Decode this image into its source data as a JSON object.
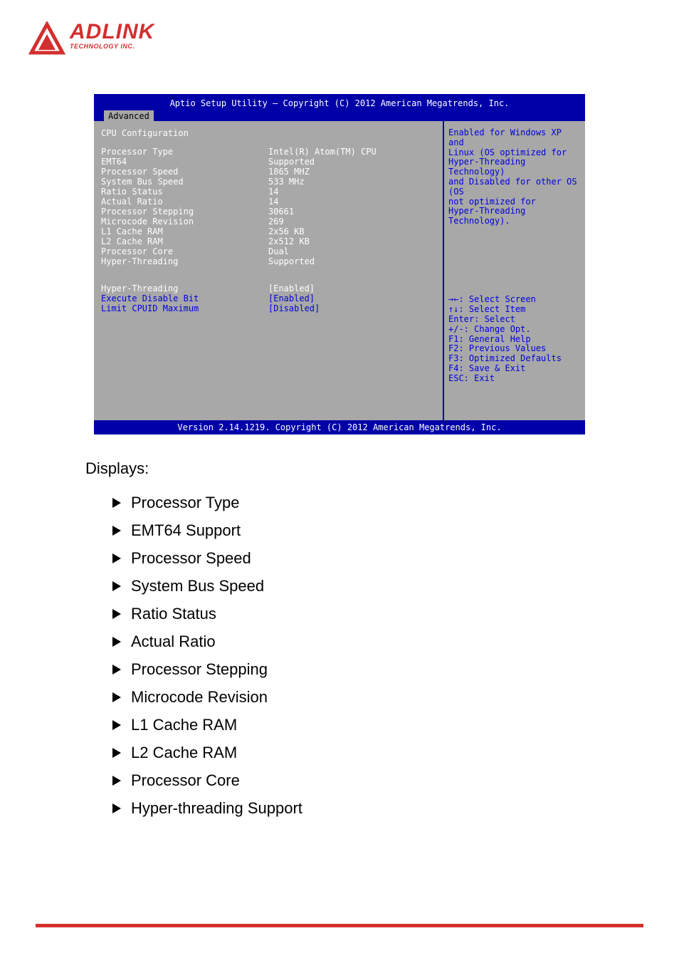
{
  "logo": {
    "main": "ADLINK",
    "sub": "TECHNOLOGY INC."
  },
  "bios": {
    "header": "Aptio Setup Utility – Copyright (C) 2012 American Megatrends, Inc.",
    "tab": "Advanced",
    "section": "CPU Configuration",
    "info": [
      {
        "label": "Processor Type",
        "value": "Intel(R) Atom(TM) CPU"
      },
      {
        "label": "EMT64",
        "value": "Supported"
      },
      {
        "label": "Processor Speed",
        "value": "1865 MHZ"
      },
      {
        "label": "System Bus Speed",
        "value": "533 MHz"
      },
      {
        "label": "Ratio Status",
        "value": "14"
      },
      {
        "label": "Actual Ratio",
        "value": "14"
      },
      {
        "label": "Processor Stepping",
        "value": "30661"
      },
      {
        "label": "Microcode Revision",
        "value": "269"
      },
      {
        "label": "L1 Cache RAM",
        "value": "2x56 KB"
      },
      {
        "label": "L2 Cache RAM",
        "value": "2x512 KB"
      },
      {
        "label": "Processor Core",
        "value": "Dual"
      },
      {
        "label": "Hyper-Threading",
        "value": "Supported"
      }
    ],
    "options": [
      {
        "label": "Hyper-Threading",
        "value": "[Enabled]",
        "selected": true
      },
      {
        "label": "Execute Disable Bit",
        "value": "[Enabled]",
        "selected": false
      },
      {
        "label": "Limit CPUID Maximum",
        "value": "[Disabled]",
        "selected": false
      }
    ],
    "help_top": [
      "Enabled for Windows XP and",
      "Linux (OS optimized for",
      "Hyper-Threading Technology)",
      "and Disabled for other OS (OS",
      "not optimized for",
      "Hyper-Threading Technology)."
    ],
    "help_bot": [
      "→←: Select Screen",
      "↑↓: Select Item",
      "Enter: Select",
      "+/-: Change Opt.",
      "F1: General Help",
      "F2: Previous Values",
      "F3: Optimized Defaults",
      "F4: Save & Exit",
      "ESC: Exit"
    ],
    "footer": "Version 2.14.1219. Copyright (C) 2012 American Megatrends, Inc."
  },
  "body": {
    "displays": "Displays:",
    "bullets": [
      "Processor Type",
      "EMT64 Support",
      "Processor Speed",
      "System Bus Speed",
      "Ratio Status",
      "Actual Ratio",
      "Processor Stepping",
      "Microcode Revision",
      "L1 Cache RAM",
      "L2 Cache RAM",
      "Processor Core",
      "Hyper-threading Support"
    ]
  }
}
